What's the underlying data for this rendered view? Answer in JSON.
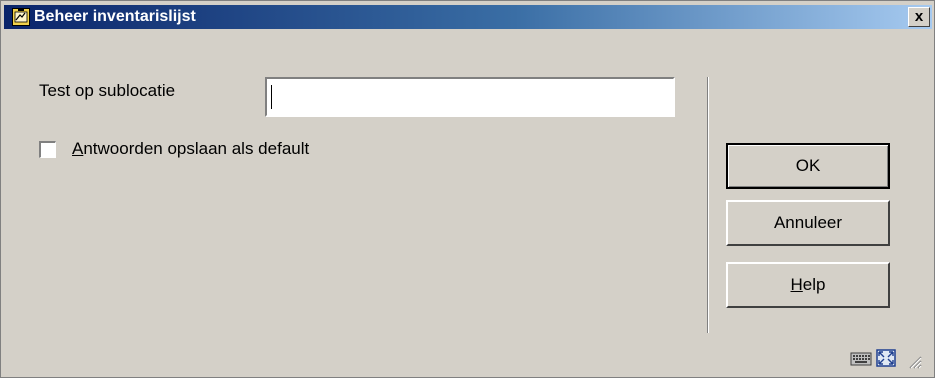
{
  "window": {
    "title": "Beheer inventarislijst",
    "close_label": "x",
    "app_icon": "app-window-icon"
  },
  "form": {
    "field_label": "Test op sublocatie",
    "field_value": "",
    "checkbox_label_accel": "A",
    "checkbox_label_rest": "ntwoorden opslaan als default",
    "checkbox_checked": false
  },
  "buttons": {
    "ok": "OK",
    "cancel": "Annuleer",
    "help_accel": "H",
    "help_rest": "elp"
  },
  "status_icons": [
    "keyboard-icon",
    "fullscreen-icon",
    "resize-grip-icon"
  ]
}
